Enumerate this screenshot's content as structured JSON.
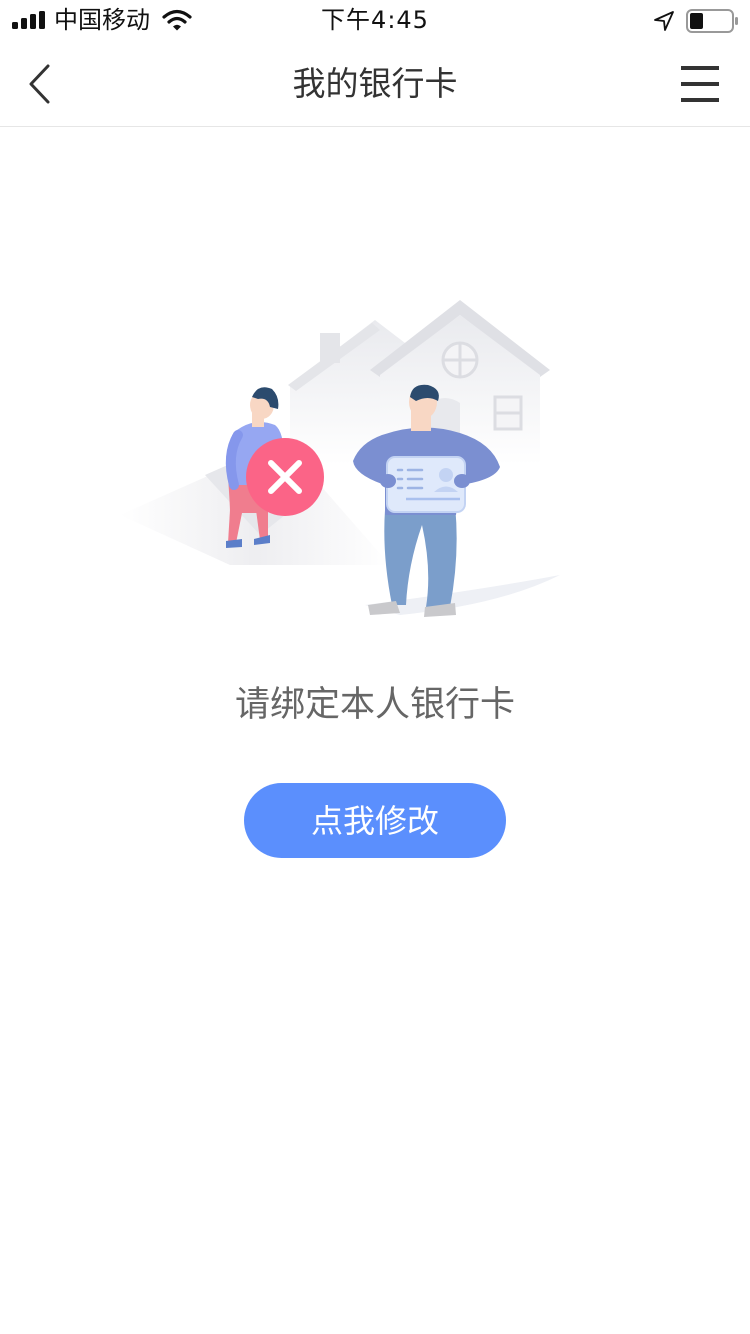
{
  "status_bar": {
    "carrier": "中国移动",
    "time": "下午4:45",
    "icons": [
      "signal-icon",
      "wifi-icon",
      "location-arrow-icon",
      "battery-icon"
    ]
  },
  "nav": {
    "title": "我的银行卡",
    "back_icon": "chevron-left-icon",
    "menu_icon": "hamburger-menu-icon"
  },
  "content": {
    "illustration": "bank-card-not-bound-illustration",
    "message": "请绑定本人银行卡",
    "button_label": "点我修改"
  },
  "colors": {
    "accent": "#5b8ffd",
    "error_badge": "#fb6487",
    "message_text": "#666666"
  }
}
